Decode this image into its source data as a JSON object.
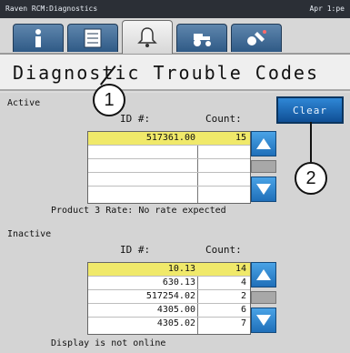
{
  "header": {
    "left": "Raven RCM:Diagnostics",
    "right": "Apr 1:pe"
  },
  "tabs": [
    {
      "icon": "info-icon"
    },
    {
      "icon": "checklist-icon"
    },
    {
      "icon": "bell-icon",
      "active": true
    },
    {
      "icon": "tractor-icon"
    },
    {
      "icon": "tool-icon"
    }
  ],
  "page": {
    "title": "Diagnostic Trouble Codes"
  },
  "active": {
    "label": "Active",
    "id_header": "ID #:",
    "count_header": "Count:",
    "rows": [
      {
        "id": "517361.00",
        "count": "15",
        "selected": true
      },
      {
        "id": "",
        "count": ""
      },
      {
        "id": "",
        "count": ""
      },
      {
        "id": "",
        "count": ""
      },
      {
        "id": "",
        "count": ""
      }
    ],
    "clear_label": "Clear",
    "message": "Product 3 Rate: No rate expected"
  },
  "inactive": {
    "label": "Inactive",
    "id_header": "ID #:",
    "count_header": "Count:",
    "rows": [
      {
        "id": "10.13",
        "count": "14",
        "selected": true
      },
      {
        "id": "630.13",
        "count": "4"
      },
      {
        "id": "517254.02",
        "count": "2"
      },
      {
        "id": "4305.00",
        "count": "6"
      },
      {
        "id": "4305.02",
        "count": "7"
      }
    ],
    "message": "Display is not online"
  },
  "callouts": {
    "one": "1",
    "two": "2"
  },
  "colors": {
    "header_bg": "#2b2f36",
    "tab_blue": "#2f5a86",
    "selected_row": "#f0e96a",
    "scroll_blue": "#1f6fb9"
  }
}
